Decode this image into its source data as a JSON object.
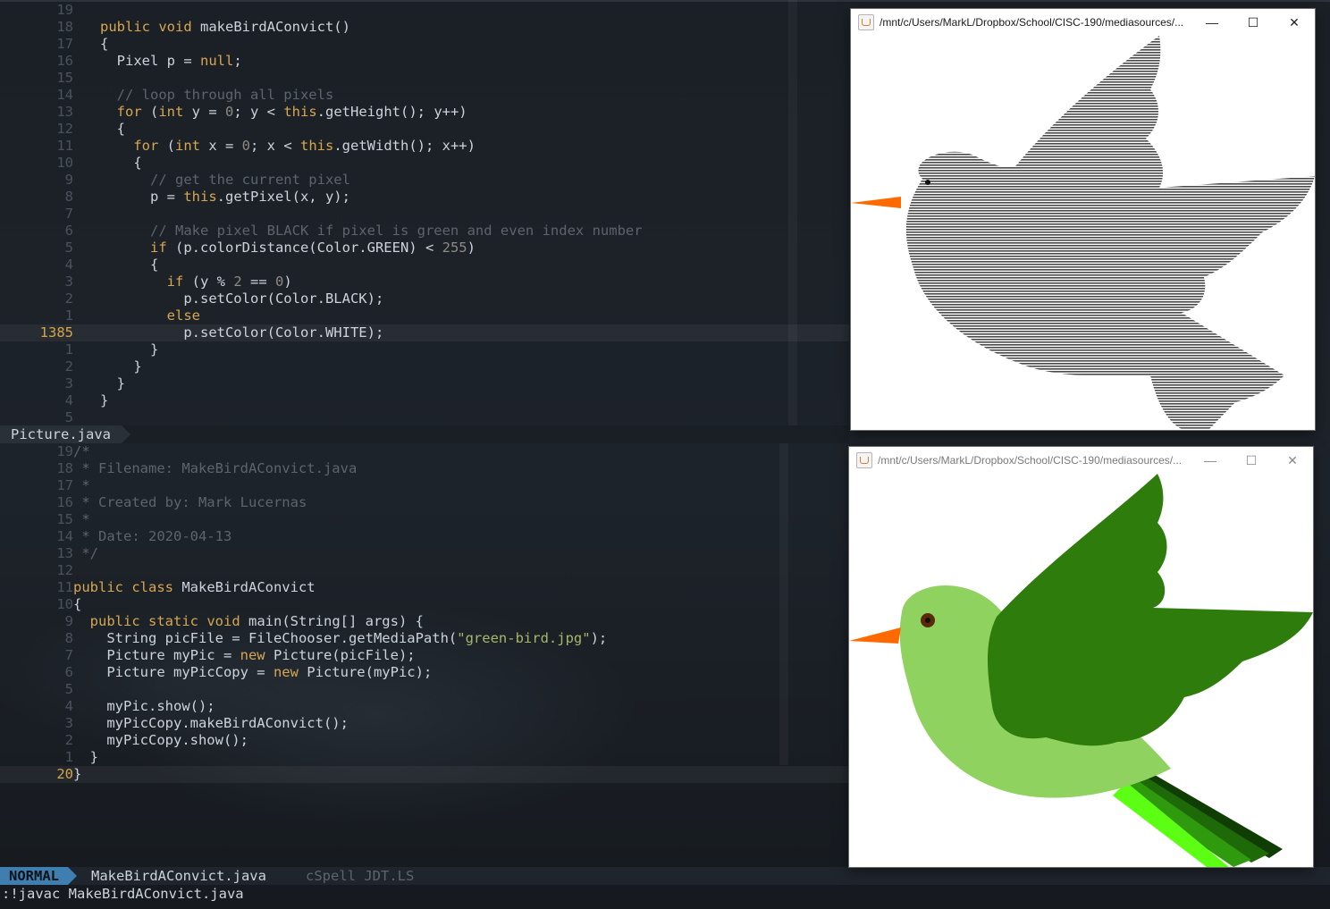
{
  "editor_top": {
    "lines": [
      {
        "ln": "19",
        "tokens": []
      },
      {
        "ln": "18",
        "tokens": [
          [
            "kw",
            "public "
          ],
          [
            "kw",
            "void "
          ],
          [
            "",
            "makeBirdAConvict()"
          ]
        ]
      },
      {
        "ln": "17",
        "tokens": [
          [
            "",
            "{"
          ]
        ]
      },
      {
        "ln": "16",
        "tokens": [
          [
            "",
            "  Pixel p = "
          ],
          [
            "kw",
            "null"
          ],
          [
            "",
            ";"
          ]
        ]
      },
      {
        "ln": "15",
        "tokens": []
      },
      {
        "ln": "14",
        "tokens": [
          [
            "cm",
            "  // loop through all pixels"
          ]
        ]
      },
      {
        "ln": "13",
        "tokens": [
          [
            "kw",
            "  for "
          ],
          [
            "",
            "("
          ],
          [
            "kw",
            "int "
          ],
          [
            "",
            "y = "
          ],
          [
            "nm",
            "0"
          ],
          [
            "",
            "; y < "
          ],
          [
            "kw",
            "this"
          ],
          [
            "",
            ".getHeight(); y++)"
          ]
        ]
      },
      {
        "ln": "12",
        "tokens": [
          [
            "",
            "  {"
          ]
        ]
      },
      {
        "ln": "11",
        "tokens": [
          [
            "kw",
            "    for "
          ],
          [
            "",
            "("
          ],
          [
            "kw",
            "int "
          ],
          [
            "",
            "x = "
          ],
          [
            "nm",
            "0"
          ],
          [
            "",
            "; x < "
          ],
          [
            "kw",
            "this"
          ],
          [
            "",
            ".getWidth(); x++)"
          ]
        ]
      },
      {
        "ln": "10",
        "tokens": [
          [
            "",
            "    {"
          ]
        ]
      },
      {
        "ln": "9",
        "tokens": [
          [
            "cm",
            "      // get the current pixel"
          ]
        ]
      },
      {
        "ln": "8",
        "tokens": [
          [
            "",
            "      p = "
          ],
          [
            "kw",
            "this"
          ],
          [
            "",
            ".getPixel(x, y);"
          ]
        ]
      },
      {
        "ln": "7",
        "tokens": []
      },
      {
        "ln": "6",
        "tokens": [
          [
            "cm",
            "      // Make pixel BLACK if pixel is green and even index number"
          ]
        ]
      },
      {
        "ln": "5",
        "tokens": [
          [
            "kw",
            "      if "
          ],
          [
            "",
            "(p.colorDistance(Color.GREEN) < "
          ],
          [
            "nm",
            "255"
          ],
          [
            "",
            ")"
          ]
        ]
      },
      {
        "ln": "4",
        "tokens": [
          [
            "",
            "      {"
          ]
        ]
      },
      {
        "ln": "3",
        "tokens": [
          [
            "kw",
            "        if "
          ],
          [
            "",
            "(y % "
          ],
          [
            "nm",
            "2"
          ],
          [
            "",
            " == "
          ],
          [
            "nm",
            "0"
          ],
          [
            "",
            ")"
          ]
        ]
      },
      {
        "ln": "2",
        "tokens": [
          [
            "",
            "          p.setColor(Color.BLACK);"
          ]
        ]
      },
      {
        "ln": "1",
        "tokens": [
          [
            "kw",
            "        else"
          ]
        ]
      },
      {
        "ln": "1385",
        "current": true,
        "tokens": [
          [
            "",
            "          p.setColor(Color.WHITE);"
          ]
        ]
      },
      {
        "ln": "1",
        "tokens": [
          [
            "",
            "      }"
          ]
        ]
      },
      {
        "ln": "2",
        "tokens": [
          [
            "",
            "    }"
          ]
        ]
      },
      {
        "ln": "3",
        "tokens": [
          [
            "",
            "  }"
          ]
        ]
      },
      {
        "ln": "4",
        "tokens": [
          [
            "",
            "}"
          ]
        ]
      },
      {
        "ln": "5",
        "tokens": []
      }
    ]
  },
  "tabline": {
    "active_tab": "Picture.java"
  },
  "editor_bottom": {
    "lines": [
      {
        "ln": "19",
        "tokens": [
          [
            "cm",
            "/*"
          ]
        ]
      },
      {
        "ln": "18",
        "tokens": [
          [
            "cm",
            " * Filename: MakeBirdAConvict.java"
          ]
        ]
      },
      {
        "ln": "17",
        "tokens": [
          [
            "cm",
            " *"
          ]
        ]
      },
      {
        "ln": "16",
        "tokens": [
          [
            "cm",
            " * Created by: Mark Lucernas"
          ]
        ]
      },
      {
        "ln": "15",
        "tokens": [
          [
            "cm",
            " *"
          ]
        ]
      },
      {
        "ln": "14",
        "tokens": [
          [
            "cm",
            " * Date: 2020-04-13"
          ]
        ]
      },
      {
        "ln": "13",
        "tokens": [
          [
            "cm",
            " */"
          ]
        ]
      },
      {
        "ln": "12",
        "tokens": []
      },
      {
        "ln": "11",
        "tokens": [
          [
            "kw",
            "public "
          ],
          [
            "kw",
            "class "
          ],
          [
            "",
            "MakeBirdAConvict"
          ]
        ]
      },
      {
        "ln": "10",
        "tokens": [
          [
            "",
            "{"
          ]
        ]
      },
      {
        "ln": "9",
        "tokens": [
          [
            "kw",
            "  public "
          ],
          [
            "kw",
            "static "
          ],
          [
            "kw",
            "void "
          ],
          [
            "",
            "main(String[] args) {"
          ]
        ]
      },
      {
        "ln": "8",
        "tokens": [
          [
            "",
            "    String picFile = FileChooser.getMediaPath("
          ],
          [
            "st",
            "\"green-bird.jpg\""
          ],
          [
            "",
            ");"
          ]
        ]
      },
      {
        "ln": "7",
        "tokens": [
          [
            "",
            "    Picture myPic = "
          ],
          [
            "kw",
            "new "
          ],
          [
            "",
            "Picture(picFile);"
          ]
        ]
      },
      {
        "ln": "6",
        "tokens": [
          [
            "",
            "    Picture myPicCopy = "
          ],
          [
            "kw",
            "new "
          ],
          [
            "",
            "Picture(myPic);"
          ]
        ]
      },
      {
        "ln": "5",
        "tokens": []
      },
      {
        "ln": "4",
        "tokens": [
          [
            "",
            "    myPic.show();"
          ]
        ]
      },
      {
        "ln": "3",
        "tokens": [
          [
            "",
            "    myPicCopy.makeBirdAConvict();"
          ]
        ]
      },
      {
        "ln": "2",
        "tokens": [
          [
            "",
            "    myPicCopy.show();"
          ]
        ]
      },
      {
        "ln": "1",
        "tokens": [
          [
            "",
            "  }"
          ]
        ]
      },
      {
        "ln": "20",
        "current": true,
        "tokens": [
          [
            "",
            "}"
          ]
        ]
      }
    ]
  },
  "statusline": {
    "mode": "NORMAL",
    "filename": "MakeBirdAConvict.java",
    "lsp": "cSpell JDT.LS"
  },
  "cmdline": ":!javac MakeBirdAConvict.java",
  "window_top": {
    "title": "/mnt/c/Users/MarkL/Dropbox/School/CISC-190/mediasources/...",
    "minimize": "—",
    "maximize": "☐",
    "close": "✕"
  },
  "window_bottom": {
    "title": "/mnt/c/Users/MarkL/Dropbox/School/CISC-190/mediasources/...",
    "minimize": "—",
    "maximize": "☐",
    "close": "✕"
  },
  "colors": {
    "bird_light_green": "#8fd25f",
    "bird_wing_green": "#2e7d0c",
    "bird_beak": "#ff6a00",
    "convict_gray": "#6a6a6a",
    "tail_1": "#5cff14",
    "tail_2": "#2f9a0d",
    "tail_3": "#1e6a08",
    "tail_4": "#0f3d04"
  }
}
